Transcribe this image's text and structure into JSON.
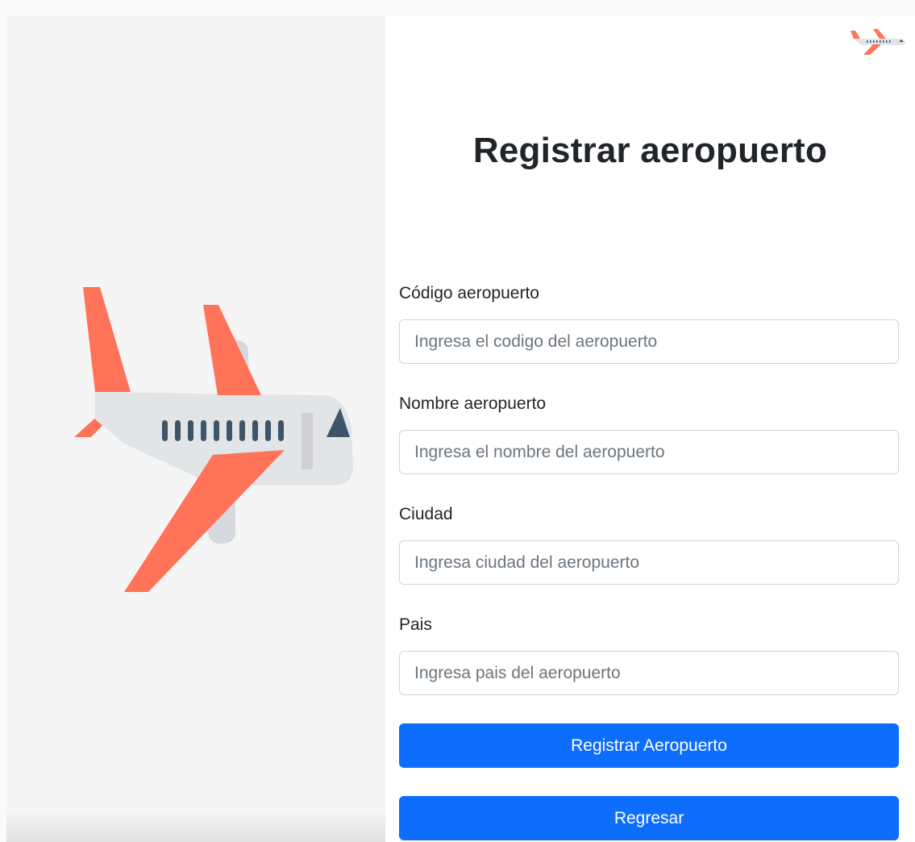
{
  "page": {
    "title": "Registrar aeropuerto"
  },
  "form": {
    "fields": [
      {
        "label": "Código aeropuerto",
        "placeholder": "Ingresa el codigo del aeropuerto",
        "value": ""
      },
      {
        "label": "Nombre aeropuerto",
        "placeholder": "Ingresa el nombre del aeropuerto",
        "value": ""
      },
      {
        "label": "Ciudad",
        "placeholder": "Ingresa ciudad del aeropuerto",
        "value": ""
      },
      {
        "label": "Pais",
        "placeholder": "Ingresa pais del aeropuerto",
        "value": ""
      }
    ],
    "register_button": "Registrar Aeropuerto",
    "back_button": "Regresar"
  },
  "icons": {
    "hero": "airplane-illustration",
    "logo": "airplane-logo-icon"
  },
  "colors": {
    "accent": "#0d6efd",
    "wing": "#ff7359",
    "fuselage": "#e1e5e7",
    "window": "#3e5469",
    "left_bg": "#f5f5f5"
  }
}
